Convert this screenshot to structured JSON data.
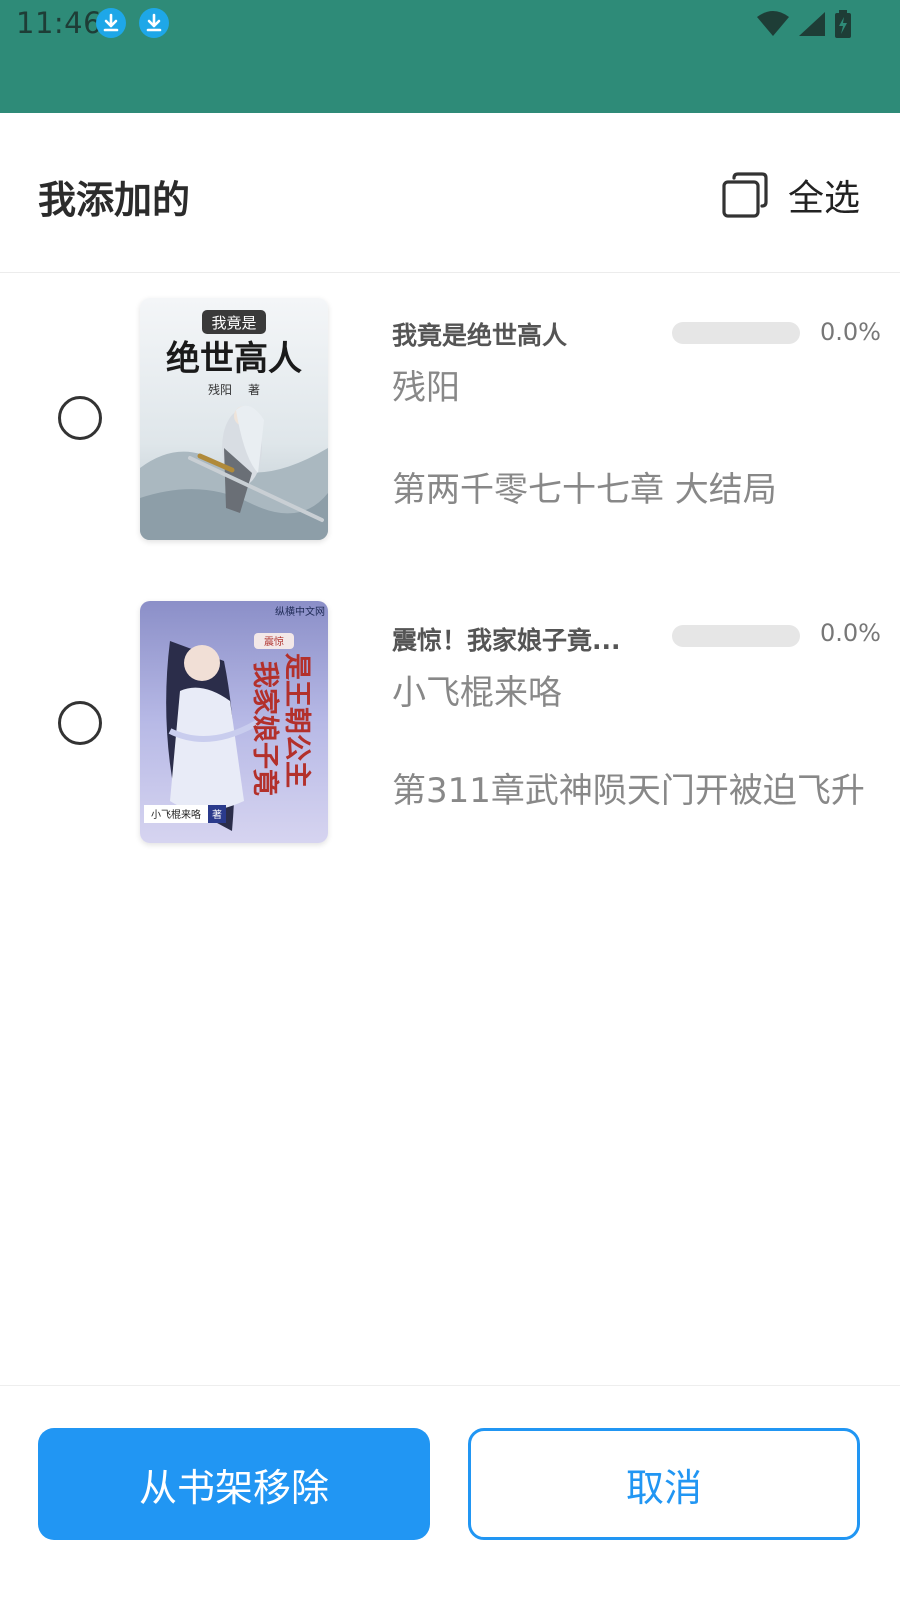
{
  "status_bar": {
    "time": "11:46",
    "icons": [
      "download-icon",
      "download-icon",
      "wifi-icon",
      "signal-icon",
      "battery-icon"
    ],
    "background": "#2e8b78"
  },
  "header": {
    "title": "我添加的",
    "select_all_label": "全选",
    "select_all_icon": "select-all-icon"
  },
  "books": [
    {
      "title": "我竟是绝世高人",
      "author": "残阳",
      "progress": "0.0%",
      "progress_value": 0.0,
      "latest_chapter": "第两千零七十七章 大结局",
      "selected": false,
      "cover_text": [
        "我竟是",
        "绝世高人",
        "残阳",
        "著"
      ]
    },
    {
      "title": "震惊！我家娘子竟...",
      "author": "小飞棍来咯",
      "progress": "0.0%",
      "progress_value": 0.0,
      "latest_chapter": "第311章武神陨天门开被迫飞升",
      "selected": false,
      "cover_text": [
        "震惊",
        "我家娘子竟",
        "是王朝公主",
        "小飞棍来咯",
        "著",
        "纵横中文网"
      ]
    }
  ],
  "actions": {
    "remove_label": "从书架移除",
    "cancel_label": "取消"
  },
  "colors": {
    "accent": "#2196f3",
    "status_bar": "#2e8b78",
    "progress_track": "#e6e6e6"
  }
}
